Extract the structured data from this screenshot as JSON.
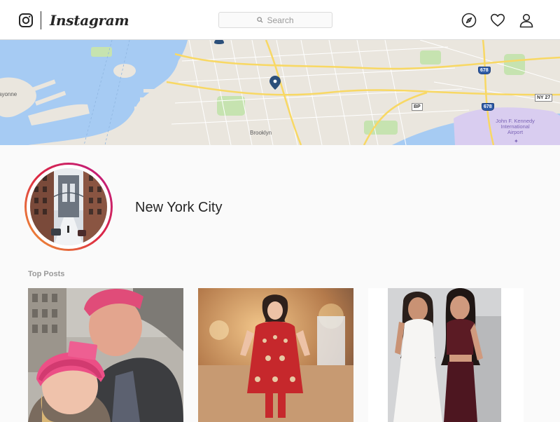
{
  "header": {
    "brand": "Instagram",
    "search": {
      "placeholder": "Search"
    },
    "nav_icons": [
      "compass-icon",
      "heart-icon",
      "user-icon"
    ]
  },
  "map": {
    "labels": {
      "bayonne": "ayonne",
      "brooklyn": "Brooklyn",
      "airport": "John F. Kennedy International Airport"
    },
    "shields": {
      "i678_top": "678",
      "i678_bottom": "678",
      "bp": "BP",
      "ny27": "NY 27"
    },
    "colors": {
      "water": "#a6cbf3",
      "land": "#eae6de",
      "park": "#c6e3b0",
      "highway": "#f8d864",
      "airport": "#d9cdf0",
      "pin": "#2b4f7a"
    }
  },
  "location": {
    "name": "New York City"
  },
  "top_posts": {
    "label": "Top Posts",
    "posts": [
      {
        "name": "post-couple-selfie"
      },
      {
        "name": "post-girl-red-dress"
      },
      {
        "name": "post-two-women"
      }
    ]
  },
  "colors": {
    "ring_gradient": [
      "#f09433",
      "#e6683c",
      "#dc2743",
      "#cc2366",
      "#bc1888"
    ],
    "muted_text": "#999999",
    "border": "#dbdbdb"
  }
}
